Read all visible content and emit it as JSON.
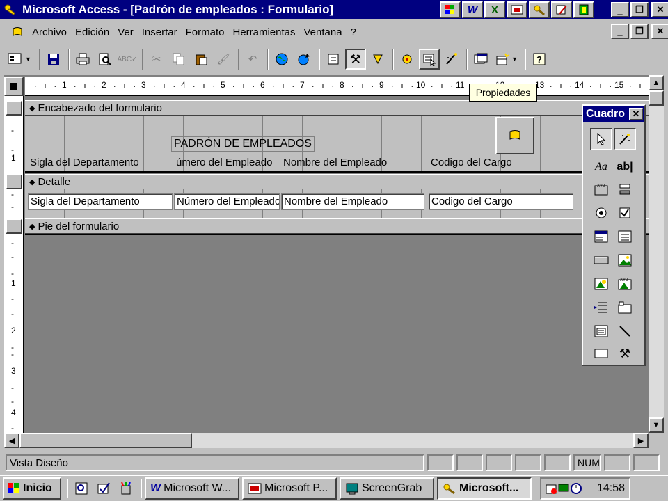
{
  "window": {
    "title": "Microsoft Access - [Padrón de empleados : Formulario]",
    "tray_icons": [
      "office-icon",
      "word-icon",
      "excel-icon",
      "powerpoint-icon",
      "access-icon",
      "outlook-icon",
      "binder-icon"
    ]
  },
  "menu": {
    "items": [
      {
        "label": "Archivo",
        "accel": "A"
      },
      {
        "label": "Edición",
        "accel": "E"
      },
      {
        "label": "Ver",
        "accel": "V"
      },
      {
        "label": "Insertar",
        "accel": "I"
      },
      {
        "label": "Formato",
        "accel": "F"
      },
      {
        "label": "Herramientas",
        "accel": "H"
      },
      {
        "label": "Ventana",
        "accel": "n"
      },
      {
        "label": "?",
        "accel": "?"
      }
    ]
  },
  "tooltip": "Propiedades",
  "ruler": {
    "marks": [
      "1",
      "2",
      "3",
      "4",
      "5",
      "6",
      "7",
      "8",
      "9",
      "10",
      "11",
      "12",
      "13",
      "14",
      "15"
    ]
  },
  "form": {
    "header_section": "Encabezado del formulario",
    "detail_section": "Detalle",
    "footer_section": "Pie del formulario",
    "title_label": "PADRÓN DE EMPLEADOS",
    "header_labels": [
      "Sigla del Departamento",
      "úmero del Empleado",
      "Nombre del Empleado",
      "Codigo del Cargo"
    ],
    "detail_fields": [
      "Sigla del Departamento",
      "Número del Empleado",
      "Nombre del Empleado",
      "Codigo del Cargo"
    ]
  },
  "toolbox": {
    "title": "Cuadro",
    "tools": [
      "select-objects-icon",
      "control-wizards-icon",
      "label-tool-icon",
      "textbox-tool-icon",
      "option-group-icon",
      "toggle-button-icon",
      "option-button-icon",
      "checkbox-icon",
      "combobox-icon",
      "listbox-icon",
      "command-button-icon",
      "image-icon",
      "unbound-object-icon",
      "bound-object-icon",
      "page-break-icon",
      "tab-control-icon",
      "subform-icon",
      "line-tool-icon",
      "rectangle-tool-icon",
      "more-controls-icon"
    ]
  },
  "status": {
    "text": "Vista Diseño",
    "num": "NUM"
  },
  "taskbar": {
    "start": "Inicio",
    "tasks": [
      "Microsoft W...",
      "Microsoft P...",
      "ScreenGrab",
      "Microsoft..."
    ],
    "clock": "14:58"
  }
}
